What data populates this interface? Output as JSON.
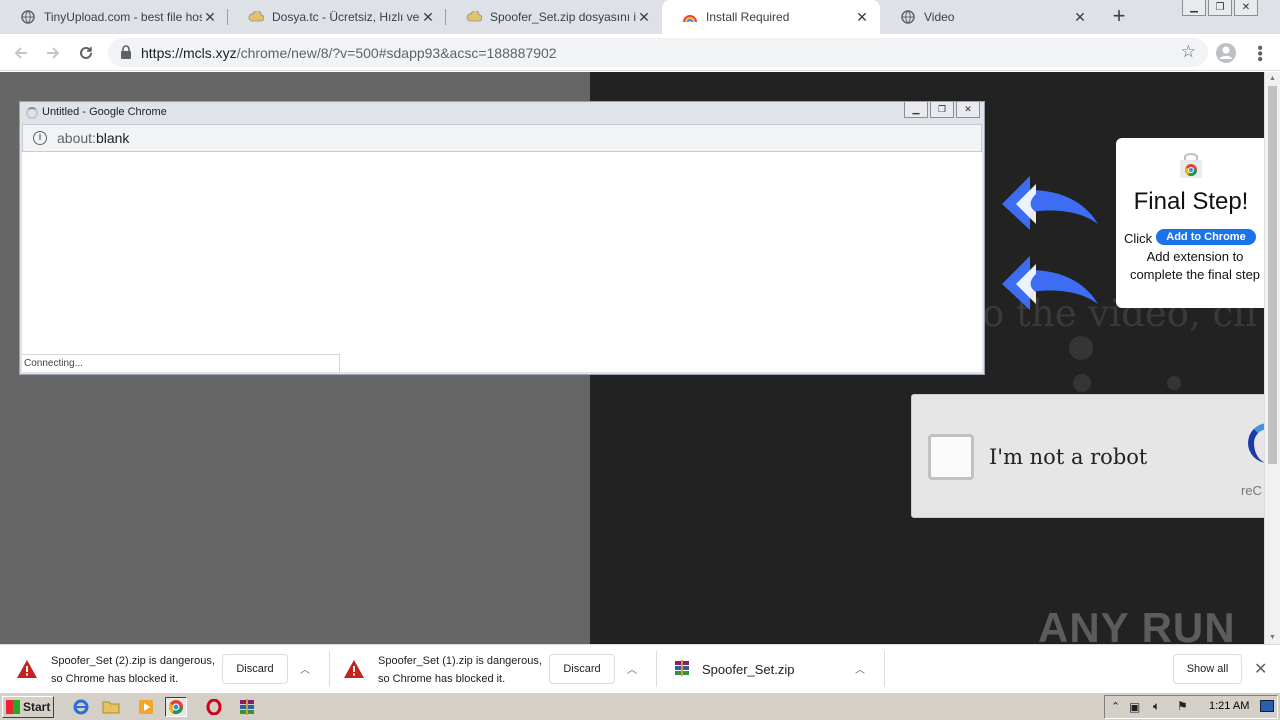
{
  "tabs": [
    {
      "title": "TinyUpload.com - best file hosting",
      "icon": "globe-icon",
      "active": false
    },
    {
      "title": "Dosya.tc - Ücretsiz, Hızlı ve Kolay",
      "icon": "cloud-icon",
      "active": false
    },
    {
      "title": "Spoofer_Set.zip dosyasını indir",
      "icon": "cloud-icon",
      "active": false
    },
    {
      "title": "Install Required",
      "icon": "rainbow-icon",
      "active": true
    },
    {
      "title": "Video",
      "icon": "globe-icon",
      "active": false
    }
  ],
  "address": {
    "host": "https://mcls.xyz",
    "path": "/chrome/new/8/?v=500#sdapp93&acsc=188887902"
  },
  "popup": {
    "title": "Untitled - Google Chrome",
    "url_scheme": "about:",
    "url_rest": "blank",
    "status": "Connecting..."
  },
  "page": {
    "background_text": "o the video, cli",
    "recaptcha_label": "I'm not a robot",
    "recaptcha_brand": "reC",
    "final_step": {
      "heading": "Final Step!",
      "click": "Click",
      "button": "Add to Chrome",
      "description": "Add extension to complete the final step"
    },
    "watermark": "ANY RUN"
  },
  "downloads": [
    {
      "line1": "Spoofer_Set (2).zip is dangerous,",
      "line2": "so Chrome has blocked it.",
      "button": "Discard"
    },
    {
      "line1": "Spoofer_Set (1).zip is dangerous,",
      "line2": "so Chrome has blocked it.",
      "button": "Discard"
    },
    {
      "filename": "Spoofer_Set.zip"
    }
  ],
  "download_bar": {
    "show_all": "Show all"
  },
  "taskbar": {
    "start": "Start",
    "clock": "1:21 AM"
  },
  "colors": {
    "accent": "#1a73e8",
    "arrow": "#3d6df2",
    "warning": "#c5221f"
  }
}
